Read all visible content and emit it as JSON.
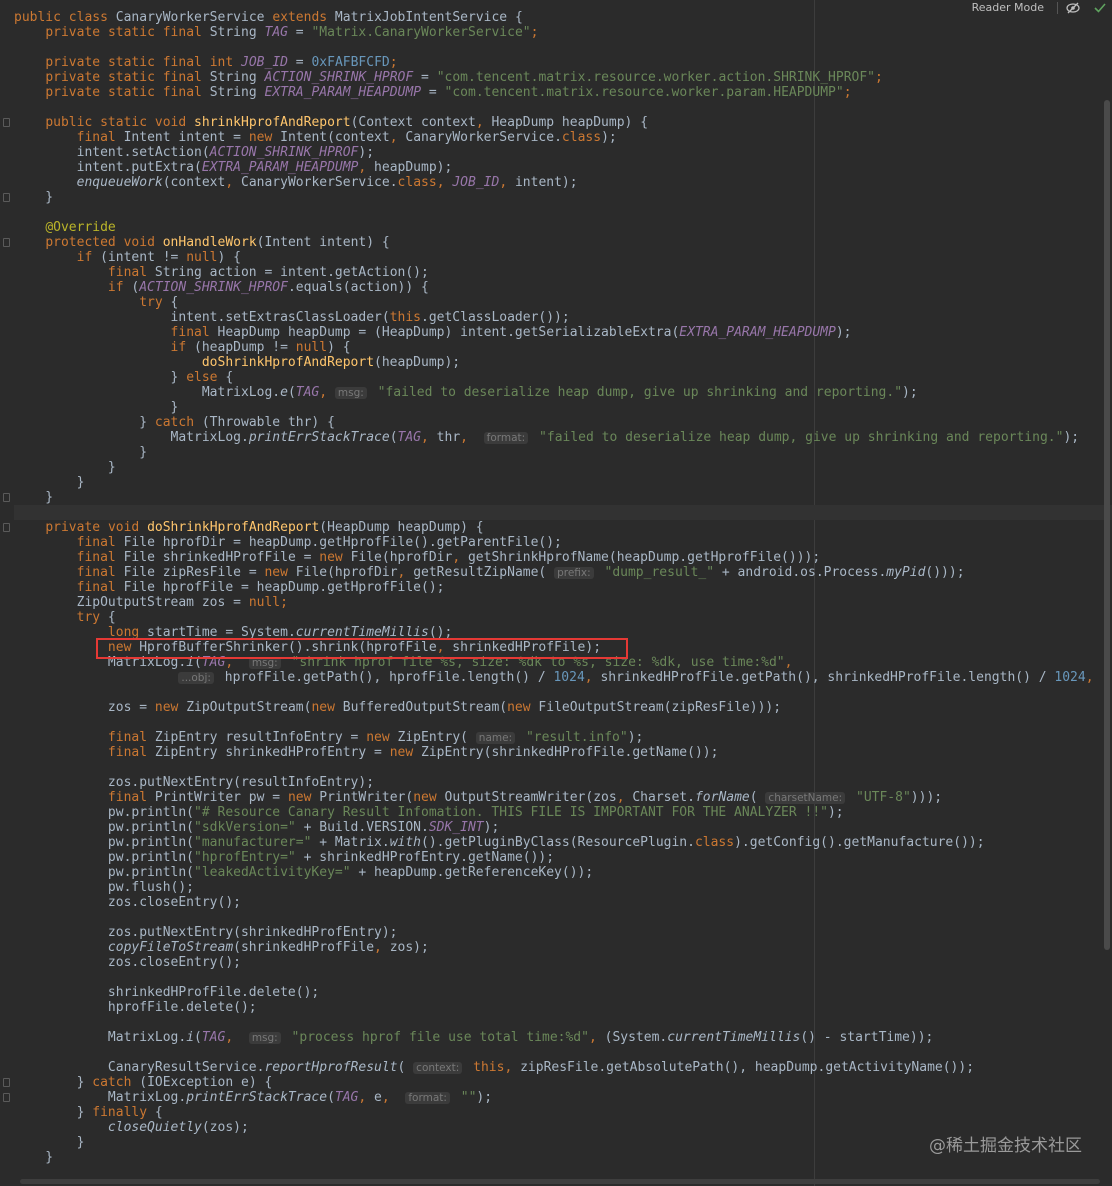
{
  "toolbar": {
    "reader_mode_label": "Reader Mode"
  },
  "watermark": "@稀土掘金技术社区",
  "colors": {
    "background": "#2b2b2b",
    "keyword": "#cc7832",
    "string": "#6a8759",
    "number": "#6897bb",
    "method": "#ffc66d",
    "constant": "#9876aa",
    "highlight_box": "#e53935"
  },
  "code": {
    "lines": [
      "public class CanaryWorkerService extends MatrixJobIntentService {",
      "    private static final String TAG = \"Matrix.CanaryWorkerService\";",
      "",
      "    private static final int JOB_ID = 0xFAFBFCFD;",
      "    private static final String ACTION_SHRINK_HPROF = \"com.tencent.matrix.resource.worker.action.SHRINK_HPROF\";",
      "    private static final String EXTRA_PARAM_HEAPDUMP = \"com.tencent.matrix.resource.worker.param.HEAPDUMP\";",
      "",
      "    public static void shrinkHprofAndReport(Context context, HeapDump heapDump) {",
      "        final Intent intent = new Intent(context, CanaryWorkerService.class);",
      "        intent.setAction(ACTION_SHRINK_HPROF);",
      "        intent.putExtra(EXTRA_PARAM_HEAPDUMP, heapDump);",
      "        enqueueWork(context, CanaryWorkerService.class, JOB_ID, intent);",
      "    }",
      "",
      "    @Override",
      "    protected void onHandleWork(Intent intent) {",
      "        if (intent != null) {",
      "            final String action = intent.getAction();",
      "            if (ACTION_SHRINK_HPROF.equals(action)) {",
      "                try {",
      "                    intent.setExtrasClassLoader(this.getClassLoader());",
      "                    final HeapDump heapDump = (HeapDump) intent.getSerializableExtra(EXTRA_PARAM_HEAPDUMP);",
      "                    if (heapDump != null) {",
      "                        doShrinkHprofAndReport(heapDump);",
      "                    } else {",
      "                        MatrixLog.e(TAG, msg: \"failed to deserialize heap dump, give up shrinking and reporting.\");",
      "                    }",
      "                } catch (Throwable thr) {",
      "                    MatrixLog.printErrStackTrace(TAG, thr,  format: \"failed to deserialize heap dump, give up shrinking and reporting.\");",
      "                }",
      "            }",
      "        }",
      "    }",
      "",
      "    private void doShrinkHprofAndReport(HeapDump heapDump) {",
      "        final File hprofDir = heapDump.getHprofFile().getParentFile();",
      "        final File shrinkedHProfFile = new File(hprofDir, getShrinkHprofName(heapDump.getHprofFile()));",
      "        final File zipResFile = new File(hprofDir, getResultZipName( prefix: \"dump_result_\" + android.os.Process.myPid()));",
      "        final File hprofFile = heapDump.getHprofFile();",
      "        ZipOutputStream zos = null;",
      "        try {",
      "            long startTime = System.currentTimeMillis();",
      "            new HprofBufferShrinker().shrink(hprofFile, shrinkedHProfFile);",
      "            MatrixLog.i(TAG,  msg: \"shrink hprof file %s, size: %dk to %s, size: %dk, use time:%d\",",
      "                     ...obj: hprofFile.getPath(), hprofFile.length() / 1024, shrinkedHProfFile.getPath(), shrinkedHProfFile.length() / 1024,",
      "",
      "            zos = new ZipOutputStream(new BufferedOutputStream(new FileOutputStream(zipResFile)));",
      "",
      "            final ZipEntry resultInfoEntry = new ZipEntry( name: \"result.info\");",
      "            final ZipEntry shrinkedHProfEntry = new ZipEntry(shrinkedHProfFile.getName());",
      "",
      "            zos.putNextEntry(resultInfoEntry);",
      "            final PrintWriter pw = new PrintWriter(new OutputStreamWriter(zos, Charset.forName( charsetName: \"UTF-8\")));",
      "            pw.println(\"# Resource Canary Result Infomation. THIS FILE IS IMPORTANT FOR THE ANALYZER !!\");",
      "            pw.println(\"sdkVersion=\" + Build.VERSION.SDK_INT);",
      "            pw.println(\"manufacturer=\" + Matrix.with().getPluginByClass(ResourcePlugin.class).getConfig().getManufacture());",
      "            pw.println(\"hprofEntry=\" + shrinkedHProfEntry.getName());",
      "            pw.println(\"leakedActivityKey=\" + heapDump.getReferenceKey());",
      "            pw.flush();",
      "            zos.closeEntry();",
      "",
      "            zos.putNextEntry(shrinkedHProfEntry);",
      "            copyFileToStream(shrinkedHProfFile, zos);",
      "            zos.closeEntry();",
      "",
      "            shrinkedHProfFile.delete();",
      "            hprofFile.delete();",
      "",
      "            MatrixLog.i(TAG,  msg: \"process hprof file use total time:%d\", (System.currentTimeMillis() - startTime));",
      "",
      "            CanaryResultService.reportHprofResult( context: this, zipResFile.getAbsolutePath(), heapDump.getActivityName());",
      "        } catch (IOException e) {",
      "            MatrixLog.printErrStackTrace(TAG, e,  format: \"\");",
      "        } finally {",
      "            closeQuietly(zos);",
      "        }",
      "    }"
    ]
  }
}
